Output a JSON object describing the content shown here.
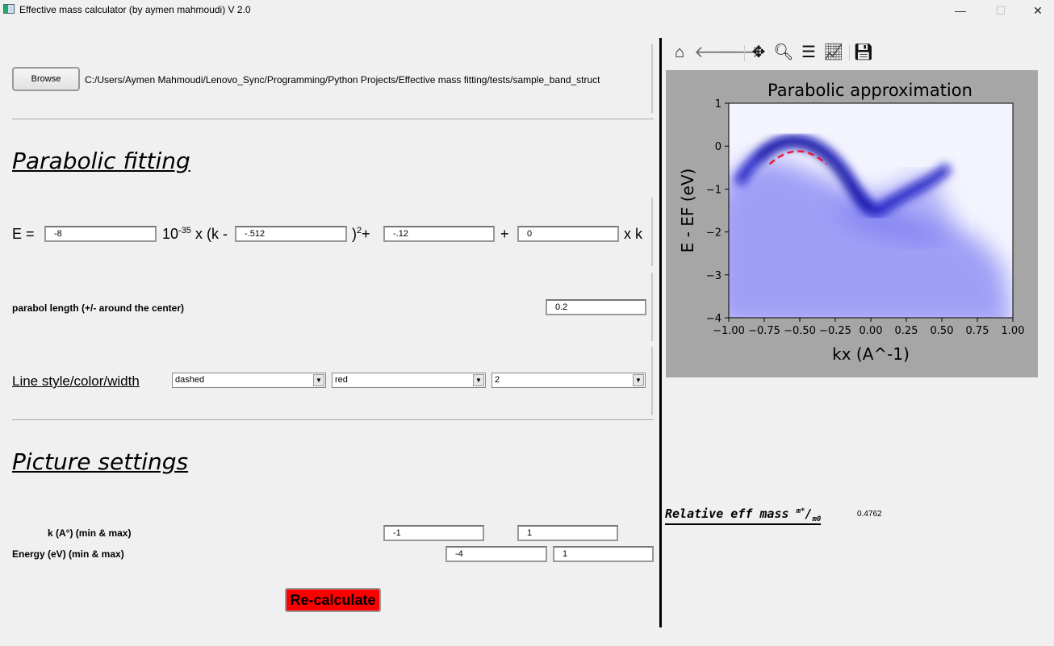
{
  "window": {
    "title": "Effective mass calculator (by aymen mahmoudi) V 2.0",
    "minimize": "—",
    "maximize": "☐",
    "close": "✕"
  },
  "file": {
    "browse_label": "Browse",
    "path": "C:/Users/Aymen Mahmoudi/Lenovo_Sync/Programming/Python Projects/Effective mass fitting/tests/sample_band_struct"
  },
  "parabolic": {
    "heading": "Parabolic fitting",
    "e_label": "E =",
    "coef": "-8",
    "power_text": "10",
    "power_exp": "-35",
    "x_k": "x (k -",
    "center": "-.512",
    "close_sq": ")",
    "sq_exp": "2",
    "plus1": "+",
    "offset": "-.12",
    "plus2": "+",
    "linear": "0",
    "xk": "x k",
    "length_label": "parabol length (+/- around the center)",
    "length": "0.2",
    "style_label": "Line style/color/width",
    "line_style": "dashed",
    "line_color": "red",
    "line_width": "2"
  },
  "picture": {
    "heading": "Picture settings",
    "k_label": "k (A°)  (min & max)",
    "k_min": "-1",
    "k_max": "1",
    "e_label": "Energy (eV)  (min & max)",
    "e_min": "-4",
    "e_max": "1"
  },
  "recalc_label": "Re-calculate",
  "toolbar": [
    "home-icon",
    "back-icon",
    "forward-icon",
    "pan-icon",
    "zoom-icon",
    "configure-icon",
    "edit-axis-icon",
    "save-icon"
  ],
  "result": {
    "label": "Relative eff mass",
    "ratio_num": "m*",
    "ratio_den": "m0",
    "value": "0.4762"
  },
  "colors": {
    "recalc": "#ff0000",
    "fit": "#e8193c",
    "band": "#0000cc",
    "figure_bg": "#a6a6a6"
  },
  "chart_data": {
    "type": "heatmap",
    "title": "Parabolic approximation",
    "xlabel": "kx (A^-1)",
    "ylabel": "E - EF (eV)",
    "xlim": [
      -1,
      1
    ],
    "ylim": [
      -4,
      1
    ],
    "xticks": [
      "−1.00",
      "−0.75",
      "−0.50",
      "−0.25",
      "0.00",
      "0.25",
      "0.50",
      "0.75",
      "1.00"
    ],
    "yticks": [
      "1",
      "0",
      "−1",
      "−2",
      "−3",
      "−4"
    ],
    "colormap": "white-blue",
    "fit": {
      "center": -0.512,
      "top": -0.12,
      "half_length": 0.2,
      "style": "dashed",
      "color": "red",
      "width": 2
    }
  }
}
